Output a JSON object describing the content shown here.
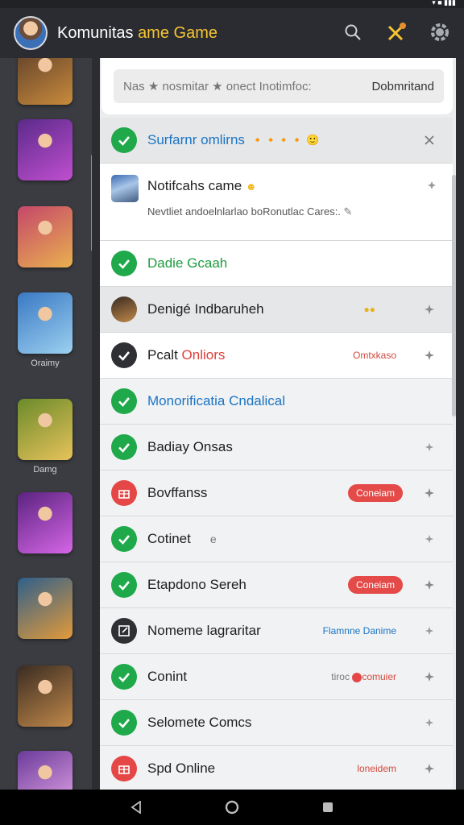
{
  "status": {
    "icons": "▾ ■ ▮▮▮"
  },
  "header": {
    "title_part1": "Komunitas ",
    "title_part2": "ame Game",
    "icons": [
      "search-icon",
      "tools-icon",
      "settings-icon"
    ]
  },
  "sidebar": {
    "games": [
      {
        "label": "",
        "colors": [
          "#5a3c2a",
          "#c98b3c"
        ]
      },
      {
        "label": "",
        "colors": [
          "#5b2a8a",
          "#c04fd0"
        ]
      },
      {
        "label": "",
        "colors": [
          "#c5476a",
          "#e9b04f"
        ]
      },
      {
        "label": "Oraimy",
        "colors": [
          "#3a79c4",
          "#9bd0f0"
        ]
      },
      {
        "label": "Damg",
        "colors": [
          "#6a8b2a",
          "#e8c25b"
        ]
      },
      {
        "label": "",
        "colors": [
          "#5b2380",
          "#d566e6"
        ]
      },
      {
        "label": "",
        "colors": [
          "#2f5f8a",
          "#e29a3a"
        ]
      },
      {
        "label": "",
        "colors": [
          "#3a2c22",
          "#c0884a"
        ]
      },
      {
        "label": "",
        "colors": [
          "#6a3b9a",
          "#e7a6e8"
        ]
      }
    ]
  },
  "search": {
    "placeholder": "Nas ★ nosmitar ★ onect Inotimfoc:",
    "right_label": "Dobmritand"
  },
  "rows": {
    "summary": {
      "label": "Surfarnr omlirns",
      "emoji": "🔸🔸🔸🔸 🙂"
    },
    "notification": {
      "title": "Notifcahs came",
      "body": "Nevtliet andoelnlarlao boRonutlac Cares:."
    },
    "r1": {
      "label": "Dadie Gcaah"
    },
    "r2": {
      "label": "Denigé Indbaruheh"
    },
    "r3": {
      "label_a": "Pcalt ",
      "label_b": "Onliors",
      "meta": "Omtxkaso"
    },
    "r4": {
      "label": "Monorificatia Cndalical"
    },
    "r5": {
      "label": "Badiay Onsas"
    },
    "r6": {
      "label": "Bovffanss",
      "pill": "Coneiam"
    },
    "r7": {
      "label": "Cotinet",
      "extra": "e"
    },
    "r8": {
      "label": "Etapdono Sereh",
      "pill": "Coneiam"
    },
    "r9": {
      "label": "Nomeme lagraritar",
      "meta": "Flamnne Danime"
    },
    "r10": {
      "label": "Conint",
      "meta_a": "tiroc",
      "meta_b": "comuier"
    },
    "r11": {
      "label": "Selomete Comcs"
    },
    "r12": {
      "label": "Spd Online",
      "meta": "loneidem"
    }
  },
  "colors": {
    "accent": "#f7c531",
    "green": "#1fa94a",
    "red": "#e54747",
    "blue": "#1b74c5"
  }
}
